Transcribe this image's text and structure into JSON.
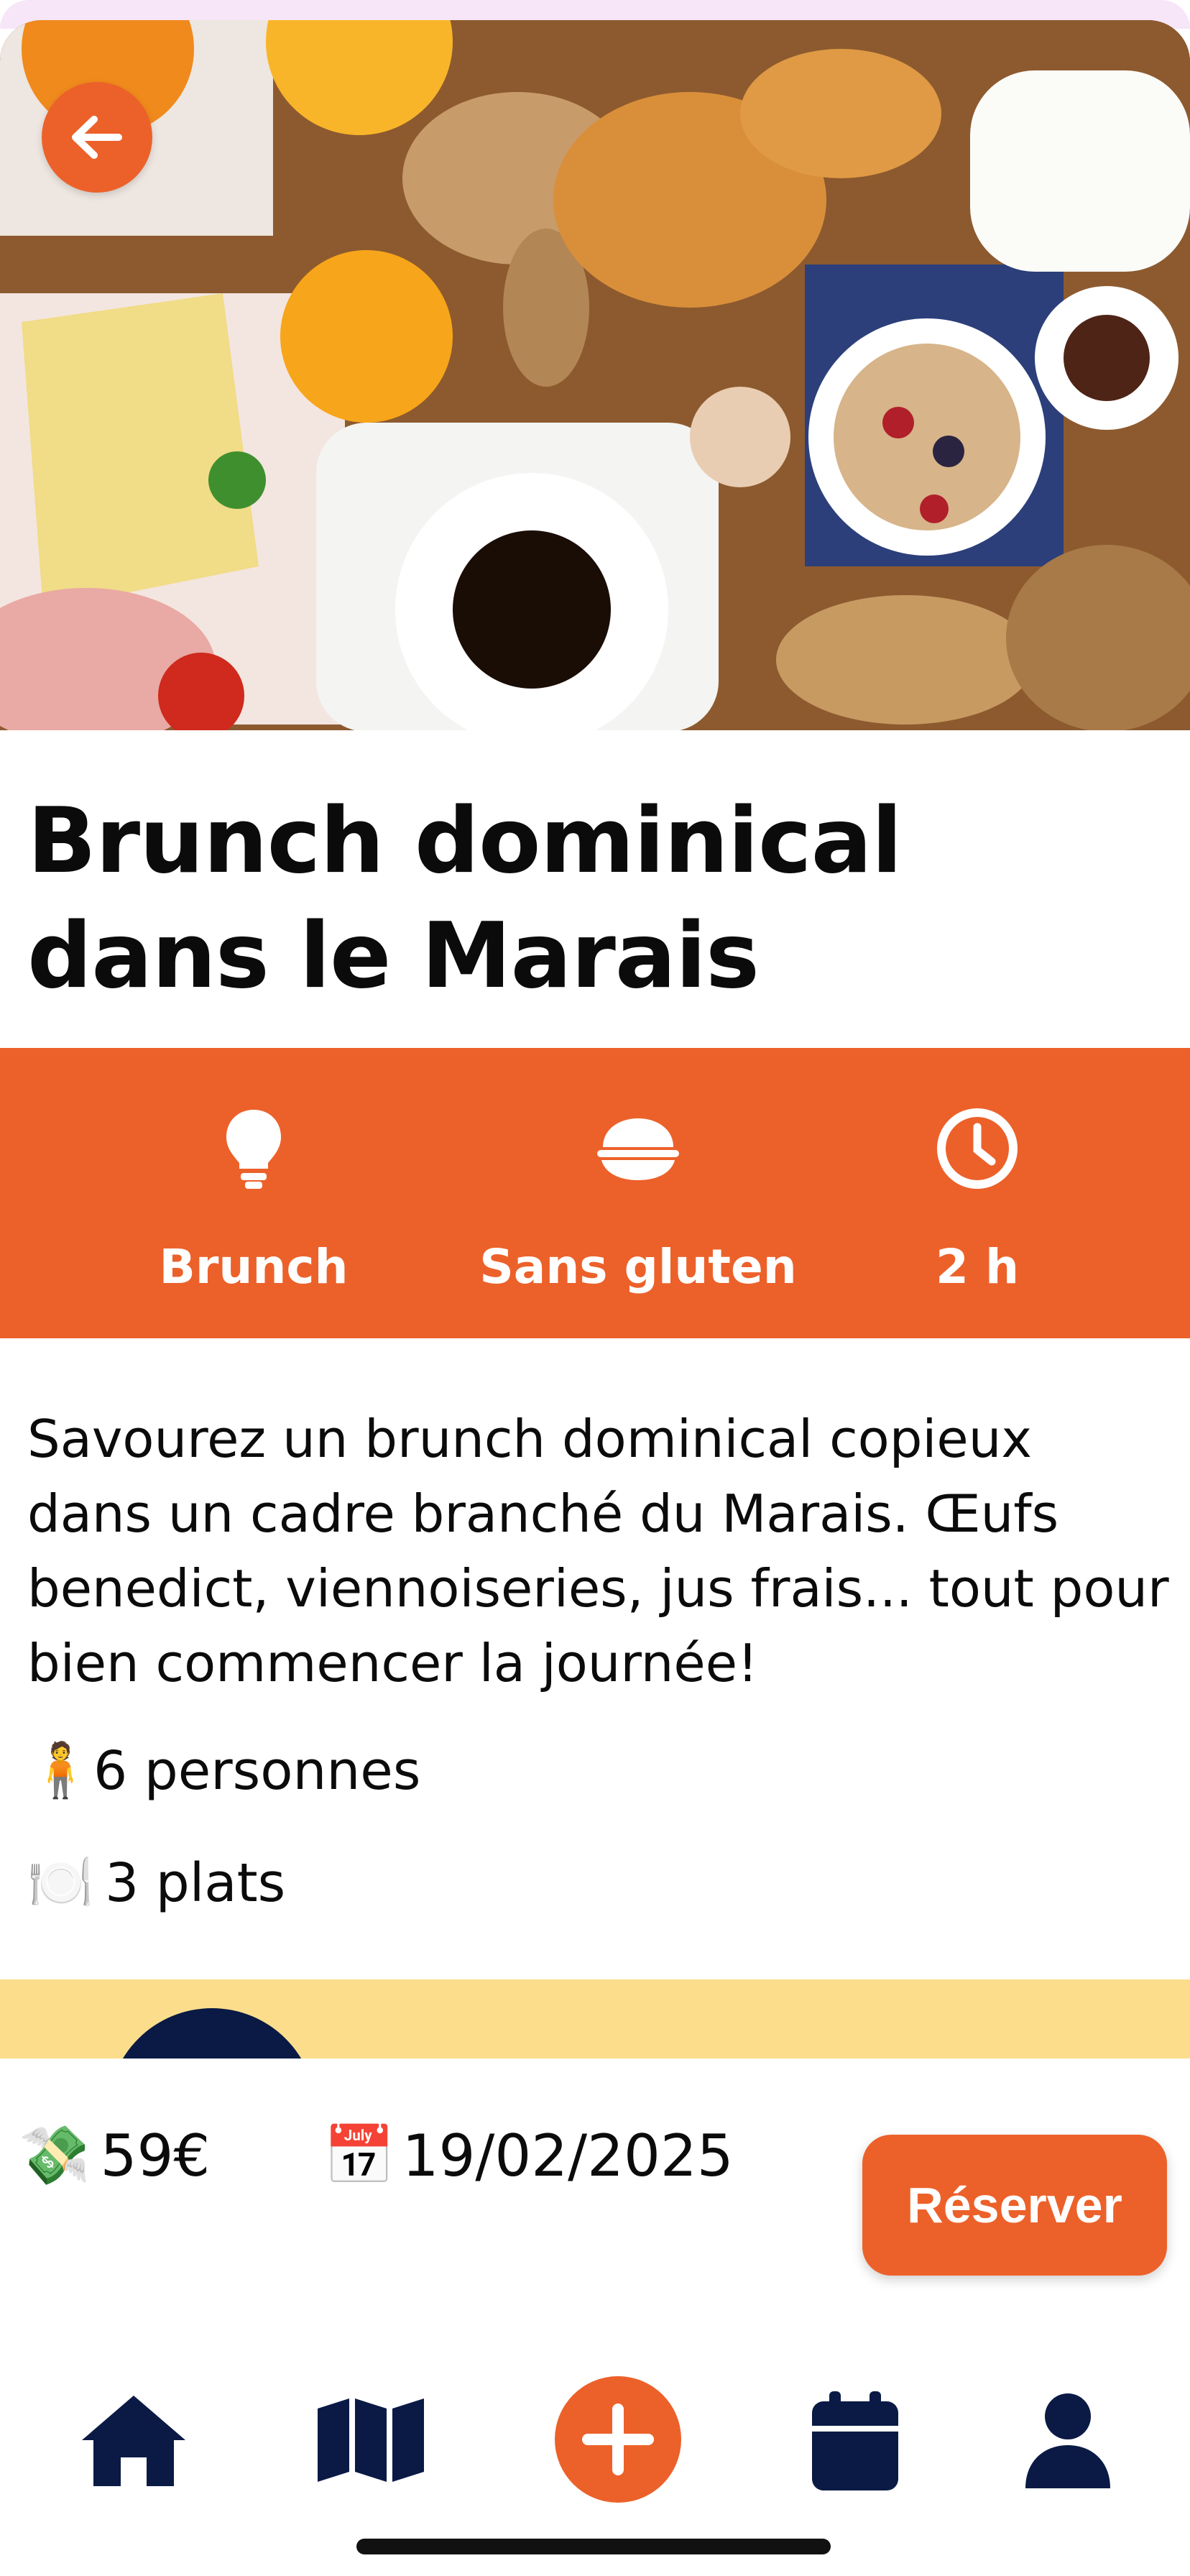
{
  "event": {
    "title": "Brunch dominical dans le Marais",
    "hero_image": "brunch-table-photo"
  },
  "features": [
    {
      "icon": "lightbulb-icon",
      "label": "Brunch"
    },
    {
      "icon": "rice-bowl-icon",
      "label": "Sans gluten"
    },
    {
      "icon": "clock-icon",
      "label": "2 h"
    }
  ],
  "description": "Savourez un brunch dominical copieux dans un cadre branché du Marais. Œufs benedict, viennoiseries, jus frais... tout pour bien commencer la journée!",
  "details": {
    "people": {
      "emoji": "🧍",
      "text": "6 personnes"
    },
    "dishes": {
      "emoji": "🍽️",
      "text": "3 plats"
    }
  },
  "booking": {
    "price_emoji": "💸",
    "price": "59€",
    "date_emoji": "📅",
    "date": "19/02/2025",
    "reserve_label": "Réserver"
  },
  "nav": {
    "items": [
      "home-icon",
      "map-icon",
      "add-icon",
      "calendar-icon",
      "user-icon"
    ]
  },
  "colors": {
    "accent": "#ec612a",
    "navy": "#0a1a45",
    "yellow": "#fbdd8b"
  }
}
